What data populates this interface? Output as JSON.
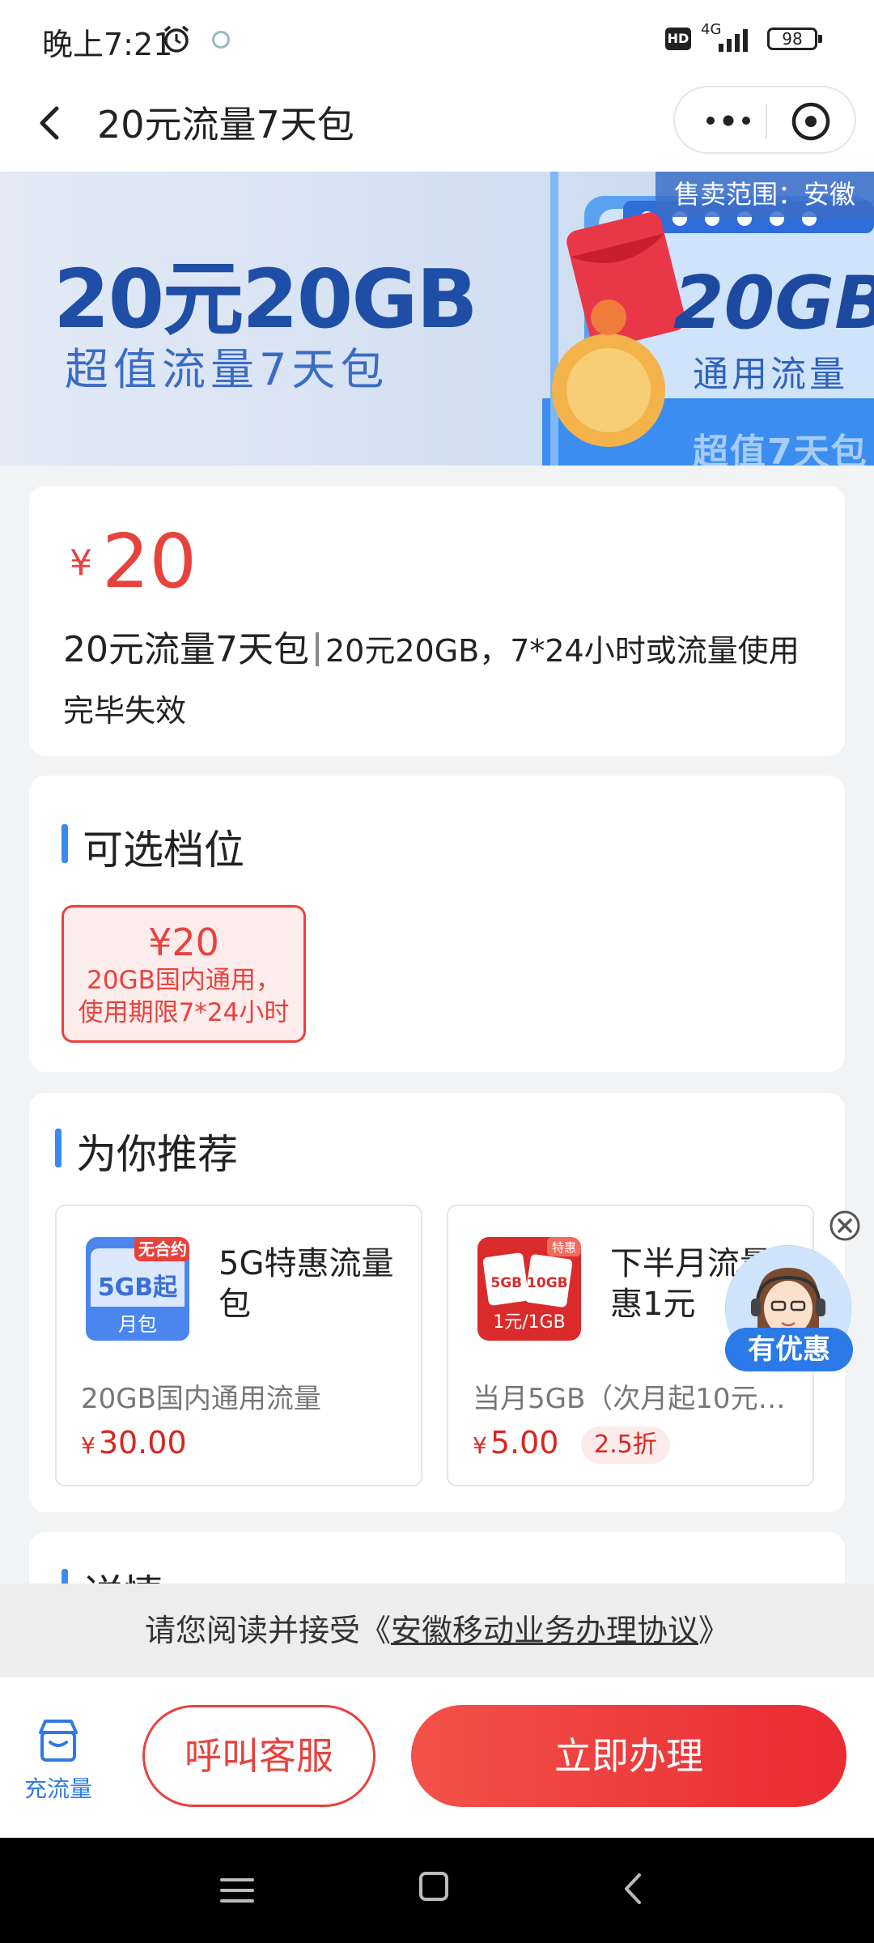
{
  "status_bar": {
    "time": "晚上7:21",
    "network": "4G",
    "hd": "HD",
    "battery": "98"
  },
  "header": {
    "title": "20元流量7天包"
  },
  "banner": {
    "headline": "20元20GB",
    "subhead": "超值流量7天包",
    "region": "售卖范围：安徽",
    "badge_amount": "20GB",
    "badge_label": "通用流量",
    "badge_caption": "超值7天包"
  },
  "product": {
    "currency": "¥",
    "price": "20",
    "name": "20元流量7天包",
    "description": "20元20GB，7*24小时或流量使用完毕失效"
  },
  "options": {
    "title": "可选档位",
    "items": [
      {
        "price": "¥20",
        "line1": "20GB国内通用，",
        "line2": "使用期限7*24小时"
      }
    ]
  },
  "recommend": {
    "title": "为你推荐",
    "products": [
      {
        "name": "5G特惠流量包",
        "img_text": "5GB起",
        "img_sub": "月包",
        "img_tag": "无合约",
        "desc": "20GB国内通用流量",
        "currency": "¥",
        "price": "30.00"
      },
      {
        "name": "下半月流量特惠1元",
        "img_text": "5GB 10GB",
        "img_sub": "1元/1GB",
        "img_tag": "特惠",
        "desc": "当月5GB（次月起10元…",
        "currency": "¥",
        "price": "5.00",
        "discount": "2.5折"
      }
    ]
  },
  "floating": {
    "label": "有优惠"
  },
  "detail": {
    "title": "详情"
  },
  "agreement": {
    "prefix": "请您阅读并接受《",
    "link": "安徽移动业务办理协议",
    "suffix": "》"
  },
  "actions": {
    "recharge_label": "充流量",
    "service_label": "呼叫客服",
    "apply_label": "立即办理"
  },
  "colors": {
    "accent_red": "#e8423d",
    "accent_blue": "#3a8bf0",
    "brand_blue": "#1e4ea6"
  }
}
